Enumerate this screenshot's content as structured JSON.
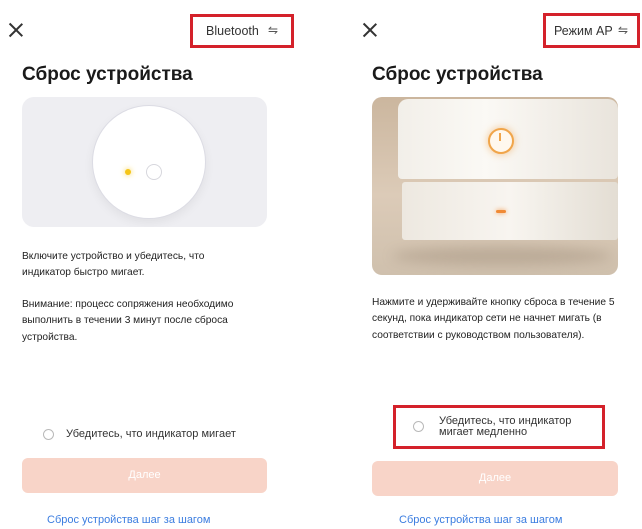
{
  "left": {
    "mode_label": "Bluetooth",
    "title": "Сброс устройства",
    "paragraph1": "Включите устройство и убедитесь, что индикатор быстро мигает.",
    "paragraph2": "Внимание: процесс сопряжения необходимо выполнить в течении 3 минут после сброса устройства.",
    "checkbox_label": "Убедитесь, что индикатор мигает",
    "next_label": "Далее",
    "guide_link": "Сброс устройства шаг за шагом"
  },
  "right": {
    "mode_label": "Режим AP",
    "title": "Сброс устройства",
    "paragraph": "Нажмите и удерживайте кнопку сброса в течение 5 секунд, пока индикатор сети не начнет мигать (в соответствии с руководством пользователя).",
    "checkbox_label": "Убедитесь, что индикатор мигает медленно",
    "next_label": "Далее",
    "guide_link": "Сброс устройства шаг за шагом"
  },
  "icons": {
    "close": "close-icon",
    "swap": "swap-arrows-icon",
    "power": "power-icon"
  },
  "colors": {
    "highlight_border": "#d4212a",
    "button_disabled": "#f8d4c8",
    "link": "#3b7de0",
    "led_yellow": "#f5c518",
    "led_orange": "#f08a35"
  }
}
